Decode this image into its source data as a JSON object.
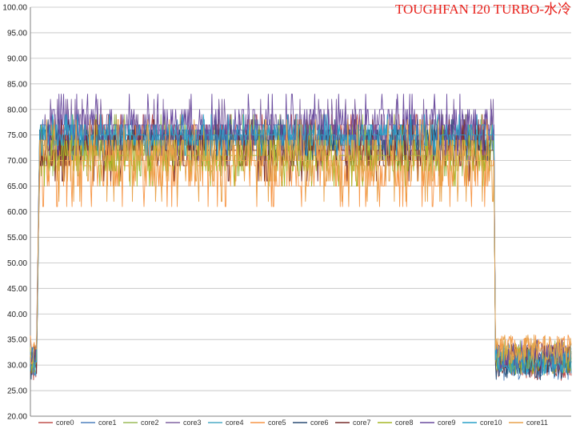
{
  "chart_data": {
    "type": "line",
    "title": "TOUGHFAN I20 TURBO-水冷",
    "xlabel": "",
    "ylabel": "",
    "ylim": [
      20,
      100
    ],
    "yticks": [
      "20.00",
      "25.00",
      "30.00",
      "35.00",
      "40.00",
      "45.00",
      "50.00",
      "55.00",
      "60.00",
      "65.00",
      "70.00",
      "75.00",
      "80.00",
      "85.00",
      "90.00",
      "95.00",
      "100.00"
    ],
    "x_range": [
      0,
      700
    ],
    "grid": "horizontal",
    "legend_position": "bottom",
    "phases": {
      "idle_start_end": 12,
      "load_end": 600
    },
    "series": [
      {
        "name": "core0",
        "color": "#c0504d",
        "idle": 30,
        "load": 75,
        "range": 2
      },
      {
        "name": "core1",
        "color": "#4f81bd",
        "idle": 30,
        "load": 74,
        "range": 2
      },
      {
        "name": "core2",
        "color": "#9bbb59",
        "idle": 32,
        "load": 73,
        "range": 3
      },
      {
        "name": "core3",
        "color": "#8064a2",
        "idle": 31,
        "load": 76,
        "range": 3
      },
      {
        "name": "core4",
        "color": "#4bacc6",
        "idle": 31,
        "load": 75,
        "range": 1
      },
      {
        "name": "core5",
        "color": "#f79646",
        "idle": 33,
        "load": 69,
        "range": 4
      },
      {
        "name": "core6",
        "color": "#2c4d75",
        "idle": 30,
        "load": 74,
        "range": 2
      },
      {
        "name": "core7",
        "color": "#772c2a",
        "idle": 31,
        "load": 72,
        "range": 3
      },
      {
        "name": "core8",
        "color": "#a6b727",
        "idle": 31,
        "load": 71,
        "range": 3
      },
      {
        "name": "core9",
        "color": "#6a4b9e",
        "idle": 32,
        "load": 77,
        "range": 3
      },
      {
        "name": "core10",
        "color": "#2aa0c8",
        "idle": 31,
        "load": 75,
        "range": 2
      },
      {
        "name": "core11",
        "color": "#e9a24b",
        "idle": 33,
        "load": 70,
        "range": 4
      }
    ]
  }
}
